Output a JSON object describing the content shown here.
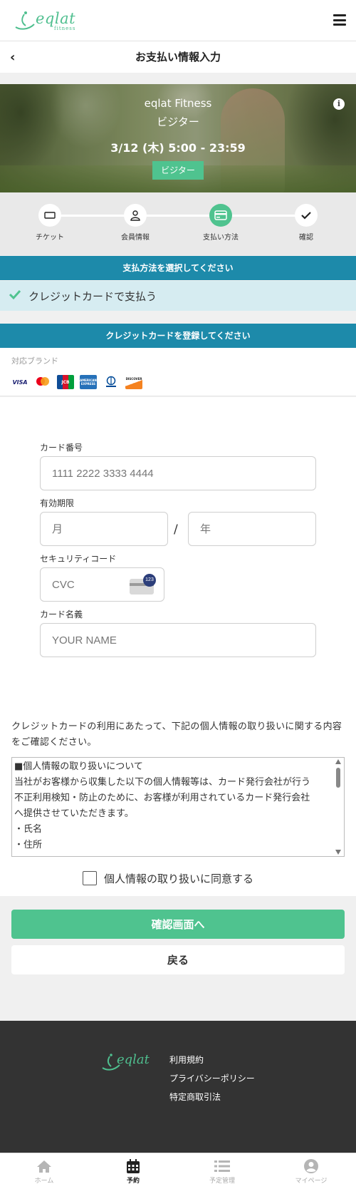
{
  "header": {
    "logo_text": "eqlat",
    "logo_sub": "fitness"
  },
  "titlebar": {
    "title": "お支払い情報入力"
  },
  "hero": {
    "studio": "eqlat Fitness",
    "plan": "ビジター",
    "datetime": "3/12 (木) 5:00 - 23:59",
    "badge": "ビジター"
  },
  "steps": [
    {
      "label": "チケット",
      "icon": "ticket-icon",
      "active": false
    },
    {
      "label": "会員情報",
      "icon": "person-icon",
      "active": false
    },
    {
      "label": "支払い方法",
      "icon": "credit-card-icon",
      "active": true
    },
    {
      "label": "確認",
      "icon": "check-icon",
      "active": false
    }
  ],
  "payment": {
    "section_title": "支払方法を選択してください",
    "option_label": "クレジットカードで支払う"
  },
  "card_section": {
    "section_title": "クレジットカードを登録してください",
    "brands_title": "対応ブランド",
    "brands": [
      "VISA",
      "Mastercard",
      "JCB",
      "AMERICAN EXPRESS",
      "Diners Club",
      "DISCOVER"
    ]
  },
  "form": {
    "card_number_label": "カード番号",
    "card_number_placeholder": "1111 2222 3333 4444",
    "expiry_label": "有効期限",
    "month_placeholder": "月",
    "year_placeholder": "年",
    "expiry_separator": "/",
    "cvc_label": "セキュリティコード",
    "cvc_placeholder": "CVC",
    "cvc_hint": "123",
    "name_label": "カード名義",
    "name_placeholder": "YOUR NAME"
  },
  "privacy": {
    "intro": "クレジットカードの利用にあたって、下記の個人情報の取り扱いに関する内容をご確認ください。",
    "lines": [
      "■個人情報の取り扱いについて",
      "当社がお客様から収集した以下の個人情報等は、カード発行会社が行う",
      "不正利用検知・防止のために、お客様が利用されているカード発行会社",
      "へ提供させていただきます。",
      "・氏名",
      "・住所"
    ],
    "agree_label": "個人情報の取り扱いに同意する",
    "agree_checked": false
  },
  "buttons": {
    "confirm": "確認画面へ",
    "back": "戻る"
  },
  "footer": {
    "logo_text": "eqlat",
    "links": [
      "利用規約",
      "プライバシーポリシー",
      "特定商取引法"
    ]
  },
  "tabbar": {
    "items": [
      {
        "label": "ホーム",
        "icon": "home-icon",
        "active": false
      },
      {
        "label": "予約",
        "icon": "calendar-icon",
        "active": true
      },
      {
        "label": "予定管理",
        "icon": "list-icon",
        "active": false
      },
      {
        "label": "マイページ",
        "icon": "user-circle-icon",
        "active": false
      }
    ]
  },
  "colors": {
    "accent_green": "#4fc38f",
    "section_blue": "#1d8aaa",
    "option_bg": "#d6ecf1",
    "footer_bg": "#333333"
  }
}
